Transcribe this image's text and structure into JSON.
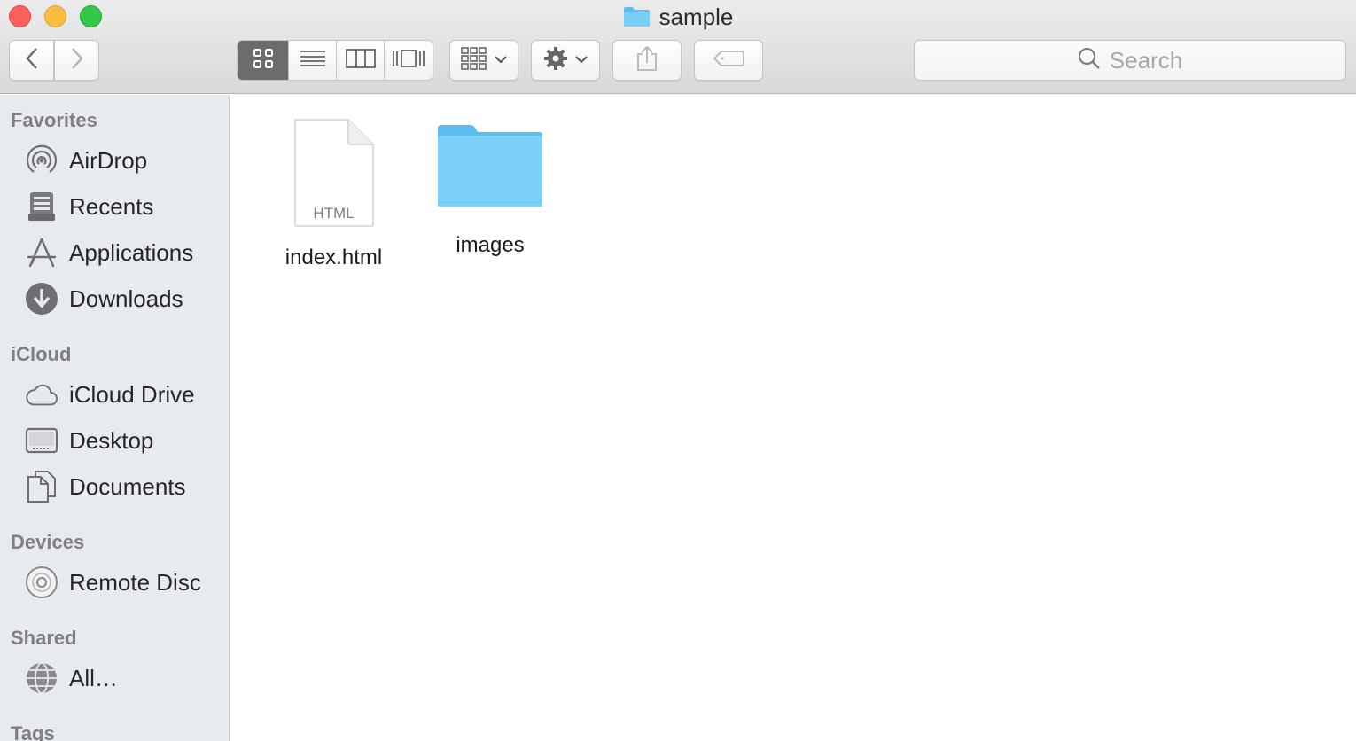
{
  "window": {
    "title": "sample",
    "title_icon": "folder-icon"
  },
  "toolbar": {
    "back_icon": "chevron-left-icon",
    "forward_icon": "chevron-right-icon",
    "view_modes": [
      {
        "name": "icon-view",
        "active": true
      },
      {
        "name": "list-view",
        "active": false
      },
      {
        "name": "column-view",
        "active": false
      },
      {
        "name": "cover-flow-view",
        "active": false
      }
    ],
    "arrange_icon": "grid-arrange-icon",
    "action_icon": "gear-icon",
    "share_icon": "share-icon",
    "tag_icon": "tag-icon",
    "search_placeholder": "Search"
  },
  "sidebar": {
    "favorites_title": "Favorites",
    "favorites": [
      {
        "label": "AirDrop",
        "icon": "airdrop-icon"
      },
      {
        "label": "Recents",
        "icon": "recents-icon"
      },
      {
        "label": "Applications",
        "icon": "applications-icon"
      },
      {
        "label": "Downloads",
        "icon": "downloads-icon"
      }
    ],
    "icloud_title": "iCloud",
    "icloud": [
      {
        "label": "iCloud Drive",
        "icon": "cloud-icon"
      },
      {
        "label": "Desktop",
        "icon": "desktop-icon"
      },
      {
        "label": "Documents",
        "icon": "documents-icon"
      }
    ],
    "devices_title": "Devices",
    "devices": [
      {
        "label": "Remote Disc",
        "icon": "disc-icon"
      }
    ],
    "shared_title": "Shared",
    "shared": [
      {
        "label": "All…",
        "icon": "network-icon"
      }
    ],
    "tags_title": "Tags"
  },
  "files": [
    {
      "name": "index.html",
      "type": "html-file",
      "badge": "HTML"
    },
    {
      "name": "images",
      "type": "folder"
    }
  ],
  "colors": {
    "folder": "#6cc8f7",
    "sidebar_bg": "#e7eaef",
    "active_segment": "#6c6c6c"
  }
}
